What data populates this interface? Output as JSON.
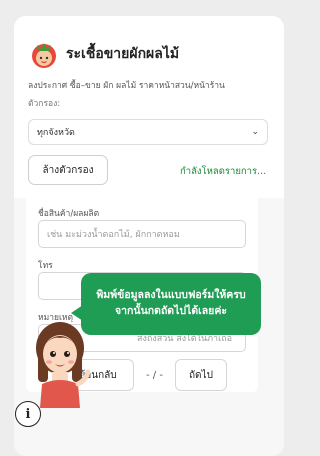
{
  "header": {
    "title": "ระเชื้อขายผักผลไม้",
    "subtitle": "ลงประกาศ ซื้อ–ขาย ผัก ผลไม้ ราคาหน้าสวน/หน้าร้าน",
    "logo_icon": "tomato-mascot-icon"
  },
  "filter": {
    "label": "ตัวกรอง:",
    "province_select": "ทุกจังหวัด",
    "clear_button": "ล้างตัวกรอง",
    "loading_text": "กำลังโหลดรายการ..."
  },
  "form": {
    "product_label": "ชื่อสินค้า/ผลผลิต",
    "product_placeholder": "เช่น มะม่วงน้ำดอกไม้, ผักกาดหอม",
    "phone_label": "โทร",
    "note_label": "หมายเหตุ",
    "note_placeholder": "ส่งถึงสวน ส่งได้ในภาเถอ"
  },
  "navigation": {
    "back_button": "ย้อนกลับ",
    "page_indicator": "- / -",
    "next_button": "ถัดไป"
  },
  "tooltip": {
    "line1": "พิมพ์ข้อมูลลงในแบบฟอร์มให้ครบ",
    "line2": "จากนั้นกดถัดไปได้เลยค่ะ"
  },
  "colors": {
    "accent_green": "#1f9d55",
    "link_green": "#1b8a3b"
  }
}
